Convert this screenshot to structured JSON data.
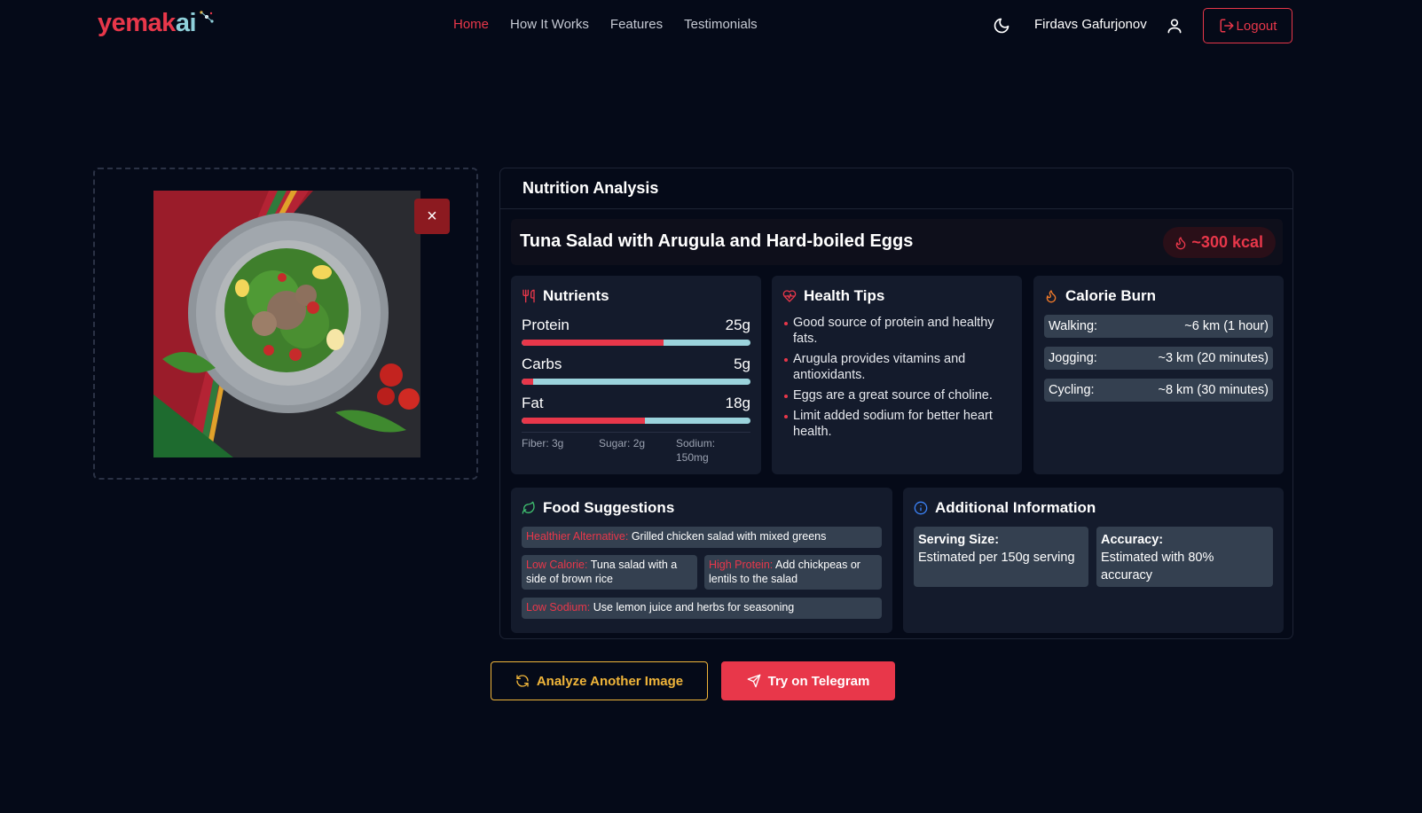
{
  "nav": {
    "logo": {
      "part1": "yema",
      "part2": "k",
      "part3": "ai"
    },
    "links": [
      "Home",
      "How It Works",
      "Features",
      "Testimonials"
    ],
    "active_link": "Home",
    "user_name": "Firdavs Gafurjonov",
    "logout_label": "Logout"
  },
  "upload": {
    "close_icon": "×"
  },
  "analysis": {
    "header": "Nutrition Analysis",
    "dish_name": "Tuna Salad with Arugula and Hard-boiled Eggs",
    "calories": "~300 kcal",
    "nutrients": {
      "title": "Nutrients",
      "items": [
        {
          "label": "Protein",
          "value": "25g",
          "fill_percent": 62
        },
        {
          "label": "Carbs",
          "value": "5g",
          "fill_percent": 5
        },
        {
          "label": "Fat",
          "value": "18g",
          "fill_percent": 54
        }
      ],
      "fiber": "Fiber: 3g",
      "sugar": "Sugar: 2g",
      "sodium_line1": "Sodium:",
      "sodium_line2": "150mg"
    },
    "health_tips": {
      "title": "Health Tips",
      "items": [
        "Good source of protein and healthy fats.",
        "Arugula provides vitamins and antioxidants.",
        "Eggs are a great source of choline.",
        "Limit added sodium for better heart health."
      ]
    },
    "calorie_burn": {
      "title": "Calorie Burn",
      "items": [
        {
          "activity": "Walking:",
          "amount": "~6 km (1 hour)"
        },
        {
          "activity": "Jogging:",
          "amount": "~3 km (20 minutes)"
        },
        {
          "activity": "Cycling:",
          "amount": "~8 km (30 minutes)"
        }
      ]
    },
    "food_suggestions": {
      "title": "Food Suggestions",
      "healthier": {
        "key": "Healthier Alternative:",
        "text": " Grilled chicken salad with mixed greens"
      },
      "low_calorie": {
        "key": "Low Calorie:",
        "text": " Tuna salad with a side of brown rice"
      },
      "high_protein": {
        "key": "High Protein:",
        "text": " Add chickpeas or lentils to the salad"
      },
      "low_sodium": {
        "key": "Low Sodium:",
        "text": " Use lemon juice and herbs for seasoning"
      }
    },
    "additional_info": {
      "title": "Additional Information",
      "serving_key": "Serving Size:",
      "serving_val": "Estimated per 150g serving",
      "accuracy_key": "Accuracy:",
      "accuracy_val": "Estimated with 80% accuracy"
    }
  },
  "actions": {
    "analyze_label": "Analyze Another Image",
    "telegram_label": "Try on Telegram"
  },
  "colors": {
    "accent_red": "#e8374a",
    "accent_teal": "#9bd3dc",
    "accent_gold": "#f0b53a",
    "background": "#050a18"
  }
}
